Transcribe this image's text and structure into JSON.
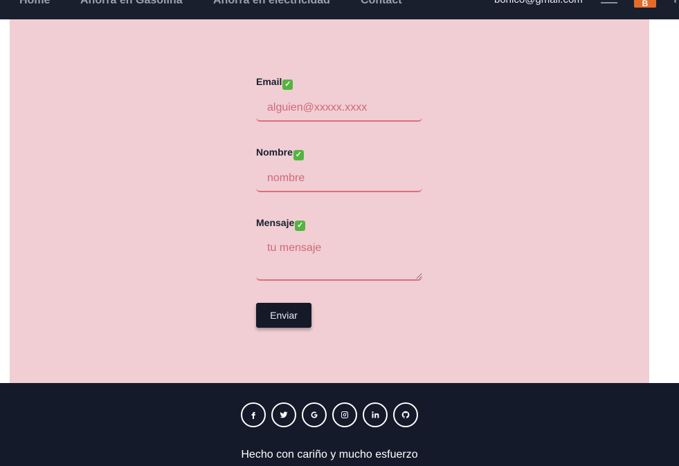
{
  "nav": {
    "links": [
      "Home",
      "Ahorra en Gasolina",
      "Ahorra en electricidad",
      "Contact"
    ],
    "user_email": "bonico@gmail.com",
    "avatar_letter": "B"
  },
  "form": {
    "email_label": "Email",
    "email_placeholder": "alguien@xxxxx.xxxx",
    "name_label": "Nombre",
    "name_placeholder": "nombre",
    "message_label": "Mensaje",
    "message_placeholder": "tu mensaje",
    "check_mark": "✓",
    "submit_label": "Enviar"
  },
  "footer": {
    "social_icons": [
      "facebook-icon",
      "twitter-icon",
      "google-icon",
      "instagram-icon",
      "linkedin-icon",
      "github-icon"
    ],
    "tagline": "Hecho con cariño y mucho esfuerzo"
  },
  "colors": {
    "nav_bg": "#1a1f2e",
    "panel_bg": "#f0ced3",
    "input_border": "#e06b7e",
    "placeholder": "#d4667a",
    "button_bg": "#151a28",
    "footer_bg": "#141a29",
    "avatar_bg": "#e26b2a",
    "check_bg": "#53b53f"
  }
}
